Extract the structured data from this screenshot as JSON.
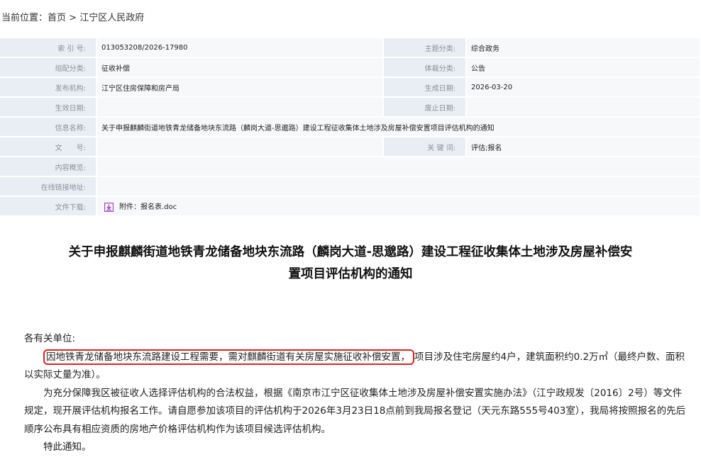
{
  "breadcrumb": {
    "prefix": "当前位置：",
    "home": "首页",
    "sep": " > ",
    "current": "江宁区人民政府"
  },
  "meta": {
    "index_label": "索 引 号:",
    "index_value": "013053208/2026-17980",
    "theme_label": "主题分类:",
    "theme_value": "综合政务",
    "org_cat_label": "组配分类:",
    "org_cat_value": "征收补偿",
    "genre_label": "体裁分类:",
    "genre_value": "公告",
    "publisher_label": "发布机构:",
    "publisher_value": "江宁区住房保障和房产局",
    "created_label": "生成日期:",
    "created_value": "2026-03-20",
    "effective_label": "生效日期:",
    "effective_value": "",
    "repeal_label": "废止日期:",
    "repeal_value": "",
    "name_label": "信息名称:",
    "name_value": "关于申报麒麟街道地铁青龙储备地块东流路（麟岗大道-思邈路）建设工程征收集体土地涉及房屋补偿安置项目评估机构的通知",
    "docno_label": "文　　号:",
    "docno_value": "",
    "keywords_label": "关 键 词:",
    "keywords_value": "评估;报名",
    "summary_label": "内容概览:",
    "summary_value": "",
    "link_label": "在线链接地址:",
    "link_value": "",
    "download_label": "文件下载:",
    "download_value": "附件：报名表.doc"
  },
  "article": {
    "title_line1": "关于申报麒麟街道地铁青龙储备地块东流路（麟岗大道-思邈路）建设工程征收集体土地涉及房屋补偿安",
    "title_line2": "置项目评估机构的通知",
    "salutation": "各有关单位:",
    "p1_highlight": "因地铁青龙储备地块东流路建设工程需要，需对麒麟街道有关房屋实施征收补偿安置，",
    "p1_rest": "项目涉及住宅房屋约4户，建筑面积约0.2万㎡（最终户数、面积以实际丈量为准）。",
    "p2": "为充分保障我区被征收人选择评估机构的合法权益，根据《南京市江宁区征收集体土地涉及房屋补偿安置实施办法》（江宁政规发〔2016〕2号）等文件规定，现开展评估机构报名工作。请自愿参加该项目的评估机构于2026年3月23日18点前到我局报名登记（天元东路555号403室），我局将按照报名的先后顺序公布具有相应资质的房地产价格评估机构作为该项目候选评估机构。",
    "p3": "特此通知。"
  },
  "colors": {
    "label_bg": "#e9eef5",
    "value_bg": "#f7f8fa",
    "highlight_border": "#e02020",
    "download_icon": "#9b3dbf"
  }
}
